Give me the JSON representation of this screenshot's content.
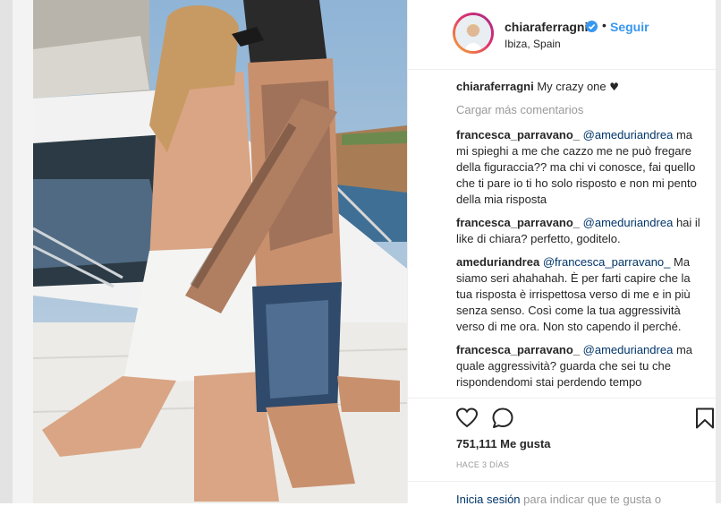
{
  "header": {
    "username": "chiaraferragni",
    "follow_label": "Seguir",
    "separator": "•",
    "location": "Ibiza, Spain"
  },
  "caption": {
    "username": "chiaraferragni",
    "text": "My crazy one",
    "emoji": "♥"
  },
  "load_more_label": "Cargar más comentarios",
  "comments": [
    {
      "user": "francesca_parravano_",
      "mention": "@ameduriandrea",
      "text": "ma mi spieghi a me che cazzo me ne può fregare della figuraccia?? ma chi vi conosce, fai quello che ti pare io ti ho solo risposto e non mi pento della mia risposta"
    },
    {
      "user": "francesca_parravano_",
      "mention": "@ameduriandrea",
      "text": "hai il like di chiara? perfetto, goditelo."
    },
    {
      "user": "ameduriandrea",
      "mention": "@francesca_parravano_",
      "text": "Ma siamo seri ahahahah. È per farti capire che la tua risposta è irrispettosa verso di me e in più senza senso. Così come la tua aggressività verso di me ora. Non sto capendo il perché."
    },
    {
      "user": "francesca_parravano_",
      "mention": "@ameduriandrea",
      "text": "ma quale aggressività? guarda che sei tu che rispondendomi stai perdendo tempo"
    }
  ],
  "likes_label": "751,111 Me gusta",
  "time_label": "HACE 3 DÍAS",
  "login": {
    "link_label": "Inicia sesión",
    "rest_label": "para indicar que te gusta o"
  },
  "colors": {
    "link_blue": "#3897f0",
    "mention_blue": "#003569",
    "muted": "#999999",
    "text": "#262626",
    "verified_badge": "#3897f0"
  },
  "icons": {
    "like": "heart-outline-icon",
    "comment": "comment-bubble-icon",
    "save": "bookmark-icon",
    "verified": "verified-check-icon"
  }
}
